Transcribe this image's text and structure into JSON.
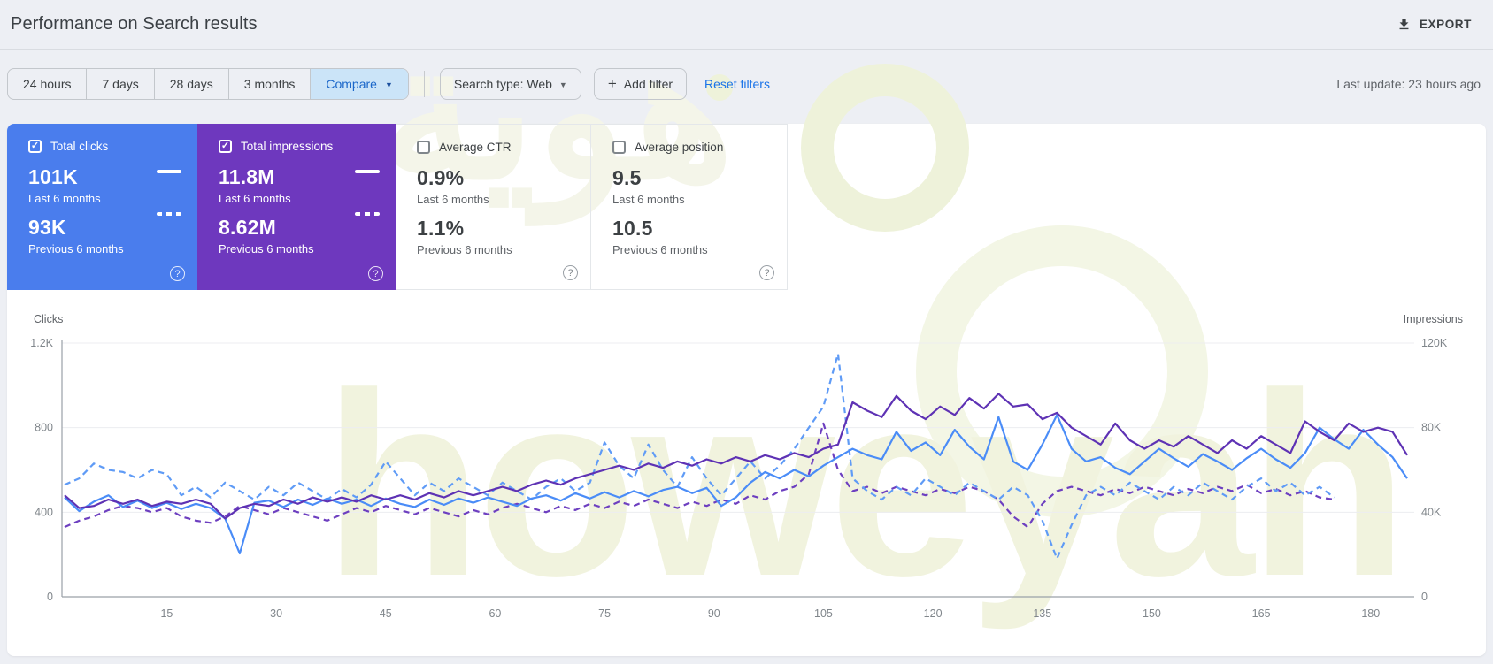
{
  "header": {
    "title": "Performance on Search results",
    "export_label": "EXPORT"
  },
  "filters": {
    "date_tabs": [
      "24 hours",
      "7 days",
      "28 days",
      "3 months"
    ],
    "compare_label": "Compare",
    "search_type_label": "Search type: Web",
    "add_filter_label": "Add filter",
    "reset_filters_label": "Reset filters",
    "last_update": "Last update: 23 hours ago"
  },
  "cards": [
    {
      "label": "Total clicks",
      "checked": true,
      "primary": "101K",
      "primary_caption": "Last 6 months",
      "secondary": "93K",
      "secondary_caption": "Previous 6 months",
      "bg": "#4a7ded"
    },
    {
      "label": "Total impressions",
      "checked": true,
      "primary": "11.8M",
      "primary_caption": "Last 6 months",
      "secondary": "8.62M",
      "secondary_caption": "Previous 6 months",
      "bg": "#6e38be"
    },
    {
      "label": "Average CTR",
      "checked": false,
      "primary": "0.9%",
      "primary_caption": "Last 6 months",
      "secondary": "1.1%",
      "secondary_caption": "Previous 6 months",
      "bg": "#ffffff"
    },
    {
      "label": "Average position",
      "checked": false,
      "primary": "9.5",
      "primary_caption": "Last 6 months",
      "secondary": "10.5",
      "secondary_caption": "Previous 6 months",
      "bg": "#ffffff"
    }
  ],
  "watermark": {
    "text": "howeyah",
    "arabic": "هوية"
  },
  "colors": {
    "accent_blue": "#1a73e8",
    "card_blue": "#4a7ded",
    "card_purple": "#6e38be",
    "line_clicks": "#4a8cf7",
    "line_clicks_prev": "#5f9bf6",
    "line_impressions": "#5e32b4",
    "line_impressions_prev": "#6d3fc0",
    "compare_bg": "#cbe4f8"
  },
  "chart_data": {
    "type": "line",
    "title": "Clicks and impressions over time (daily, 6 months vs previous 6 months)",
    "x_start": 1,
    "x_step": 2,
    "x_ticks": [
      15,
      30,
      45,
      60,
      75,
      90,
      105,
      120,
      135,
      150,
      165,
      180
    ],
    "left_axis": {
      "label": "Clicks",
      "max": 1200,
      "tick_values": [
        1200,
        800,
        400,
        0
      ],
      "tick_labels": [
        "1.2K",
        "800",
        "400",
        "0"
      ]
    },
    "right_axis": {
      "label": "Impressions",
      "max": 120,
      "unit": "K",
      "tick_values": [
        120,
        80,
        40,
        0
      ],
      "tick_labels": [
        "120K",
        "80K",
        "40K",
        "0"
      ]
    },
    "grid": true,
    "legend_position": "cards-above",
    "series": [
      {
        "name": "Clicks — last 6 months",
        "axis": "left",
        "style": "solid",
        "color": "#4a8cf7",
        "values": [
          470,
          405,
          450,
          480,
          425,
          455,
          420,
          445,
          415,
          440,
          420,
          370,
          205,
          445,
          455,
          425,
          460,
          435,
          465,
          440,
          460,
          430,
          465,
          440,
          425,
          460,
          435,
          465,
          445,
          470,
          450,
          430,
          465,
          480,
          455,
          490,
          465,
          495,
          470,
          500,
          475,
          505,
          520,
          490,
          515,
          430,
          470,
          540,
          590,
          560,
          600,
          570,
          620,
          660,
          700,
          670,
          650,
          780,
          690,
          730,
          670,
          790,
          710,
          650,
          850,
          640,
          600,
          720,
          860,
          700,
          640,
          660,
          610,
          580,
          640,
          700,
          655,
          615,
          675,
          640,
          600,
          655,
          700,
          650,
          610,
          680,
          800,
          745,
          700,
          790,
          720,
          660,
          560
        ]
      },
      {
        "name": "Clicks — previous 6 months",
        "axis": "left",
        "style": "dashed",
        "color": "#5f9bf6",
        "values": [
          530,
          560,
          630,
          600,
          590,
          560,
          600,
          580,
          480,
          520,
          470,
          540,
          500,
          460,
          520,
          480,
          540,
          500,
          460,
          510,
          470,
          530,
          640,
          560,
          480,
          540,
          500,
          560,
          520,
          480,
          540,
          500,
          460,
          520,
          560,
          500,
          540,
          730,
          620,
          560,
          720,
          600,
          520,
          660,
          560,
          480,
          560,
          640,
          560,
          620,
          700,
          800,
          900,
          1150,
          560,
          500,
          460,
          520,
          480,
          560,
          520,
          480,
          540,
          500,
          460,
          520,
          480,
          360,
          180,
          340,
          480,
          520,
          480,
          540,
          500,
          460,
          520,
          480,
          540,
          500,
          460,
          520,
          560,
          500,
          540,
          480,
          520,
          470
        ]
      },
      {
        "name": "Impressions — last 6 months",
        "axis": "right",
        "style": "solid",
        "color": "#5e32b4",
        "unit": "K",
        "values": [
          48,
          42,
          43,
          46,
          44,
          46,
          43,
          45,
          44,
          46,
          44,
          37,
          42,
          44,
          43,
          46,
          44,
          47,
          45,
          47,
          45,
          48,
          46,
          48,
          46,
          49,
          47,
          50,
          48,
          50,
          52,
          50,
          53,
          55,
          53,
          56,
          58,
          60,
          62,
          60,
          63,
          61,
          64,
          62,
          65,
          63,
          66,
          64,
          67,
          65,
          68,
          66,
          70,
          72,
          92,
          88,
          85,
          95,
          88,
          84,
          90,
          86,
          94,
          89,
          96,
          90,
          91,
          84,
          87,
          80,
          76,
          72,
          82,
          74,
          70,
          74,
          71,
          76,
          72,
          68,
          74,
          70,
          76,
          72,
          68,
          83,
          78,
          74,
          82,
          78,
          80,
          78,
          67
        ]
      },
      {
        "name": "Impressions — previous 6 months",
        "axis": "right",
        "style": "dashed",
        "color": "#6d3fc0",
        "unit": "K",
        "values": [
          33,
          36,
          38,
          41,
          43,
          42,
          40,
          42,
          38,
          36,
          35,
          38,
          43,
          41,
          39,
          42,
          40,
          38,
          36,
          39,
          42,
          40,
          43,
          41,
          39,
          42,
          40,
          38,
          41,
          39,
          42,
          44,
          42,
          40,
          43,
          41,
          44,
          42,
          45,
          43,
          46,
          44,
          42,
          45,
          43,
          46,
          44,
          48,
          46,
          50,
          52,
          58,
          82,
          60,
          50,
          52,
          49,
          52,
          50,
          48,
          51,
          49,
          52,
          50,
          46,
          38,
          33,
          44,
          50,
          52,
          50,
          48,
          51,
          49,
          52,
          50,
          48,
          51,
          49,
          52,
          50,
          53,
          49,
          51,
          48,
          50,
          47,
          46
        ]
      }
    ]
  }
}
